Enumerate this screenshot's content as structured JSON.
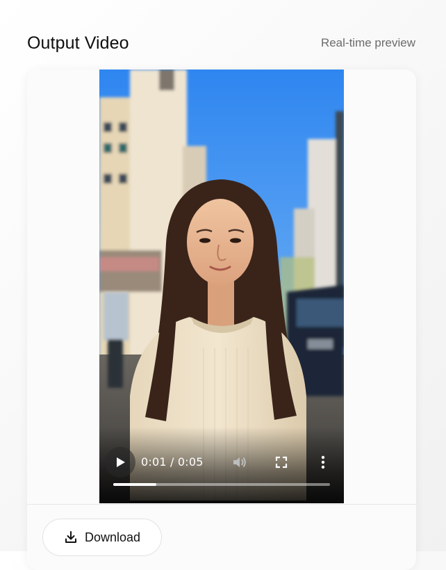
{
  "header": {
    "title": "Output Video",
    "subtitle": "Real-time preview"
  },
  "player": {
    "current_time": "0:01",
    "duration": "0:05",
    "time_display": "0:01 / 0:05",
    "progress_fraction": 0.2,
    "play_icon": "play-icon",
    "volume_icon": "volume-icon",
    "fullscreen_icon": "fullscreen-icon",
    "more_icon": "more-options-icon"
  },
  "actions": {
    "download_label": "Download",
    "download_icon": "download-icon"
  },
  "colors": {
    "sky": "#3f8ff0",
    "sweater": "#e8dcc4",
    "hair": "#3a241a",
    "button_border": "#e2e2e2"
  }
}
